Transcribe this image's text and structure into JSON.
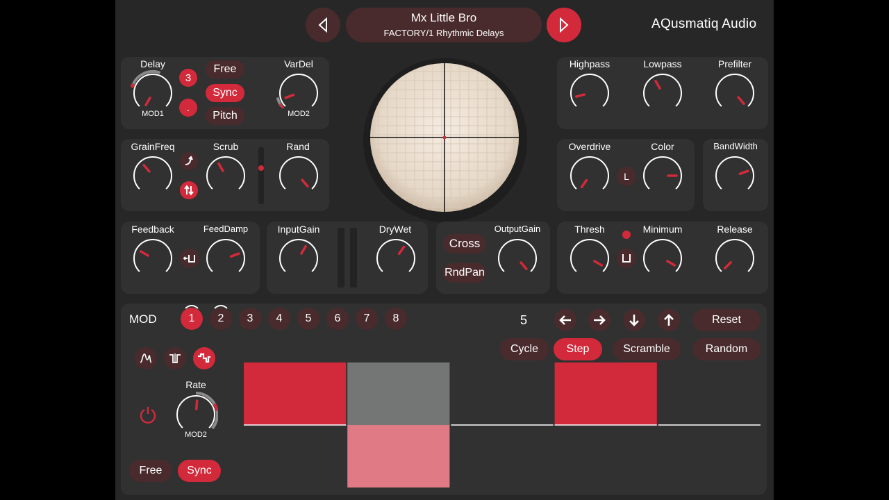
{
  "colors": {
    "accent": "#d22a3b",
    "accent_dark": "#4a2b2d",
    "panel": "#313131",
    "background": "#272727",
    "step_gray": "#747676",
    "step_pink": "#e07a84"
  },
  "header": {
    "preset_name": "Mx Little Bro",
    "preset_bank": "FACTORY/1 Rhythmic Delays",
    "brand": "AQusmatiq Audio",
    "prev_icon": "triangle-left-icon",
    "next_icon": "triangle-right-icon"
  },
  "delay": {
    "delay_label": "Delay",
    "delay_mod": "MOD1",
    "division": "3",
    "dot": ".",
    "free": "Free",
    "sync": "Sync",
    "pitch": "Pitch",
    "vardel_label": "VarDel",
    "vardel_mod": "MOD2"
  },
  "grain": {
    "grainfreq": "GrainFreq",
    "scrub": "Scrub",
    "rand": "Rand",
    "curve_icon": "curve-arrow-icon",
    "swap_icon": "swap-arrows-icon"
  },
  "feedback": {
    "feedback": "Feedback",
    "feeddamp": "FeedDamp",
    "fb_icon": "feedback-loop-icon"
  },
  "gain": {
    "inputgain": "InputGain",
    "drywet": "DryWet"
  },
  "output": {
    "cross": "Cross",
    "rndpan": "RndPan",
    "outputgain": "OutputGain"
  },
  "filters": {
    "highpass": "Highpass",
    "lowpass": "Lowpass",
    "prefilter": "Prefilter"
  },
  "drive": {
    "overdrive": "Overdrive",
    "color": "Color",
    "link": "L",
    "bandwidth": "BandWidth"
  },
  "dynamics": {
    "thresh": "Thresh",
    "minimum": "Minimum",
    "release": "Release",
    "gate_icon": "gate-icon"
  },
  "mod": {
    "title": "MOD",
    "slots": [
      "1",
      "2",
      "3",
      "4",
      "5",
      "6",
      "7",
      "8"
    ],
    "active_slot": "1",
    "steps_count": "5",
    "arrows": [
      "arrow-left-icon",
      "arrow-right-icon",
      "arrow-down-icon",
      "arrow-up-icon"
    ],
    "reset": "Reset",
    "cycle": "Cycle",
    "step": "Step",
    "scramble": "Scramble",
    "random": "Random",
    "shape_icons": [
      "envelope-shape-icon",
      "square-shape-icon",
      "step-shape-icon"
    ],
    "power_icon": "power-icon",
    "rate": "Rate",
    "rate_mod": "MOD2",
    "free": "Free",
    "sync": "Sync",
    "step_values": [
      1.0,
      -1.0,
      0.0,
      1.0,
      0.0
    ]
  }
}
